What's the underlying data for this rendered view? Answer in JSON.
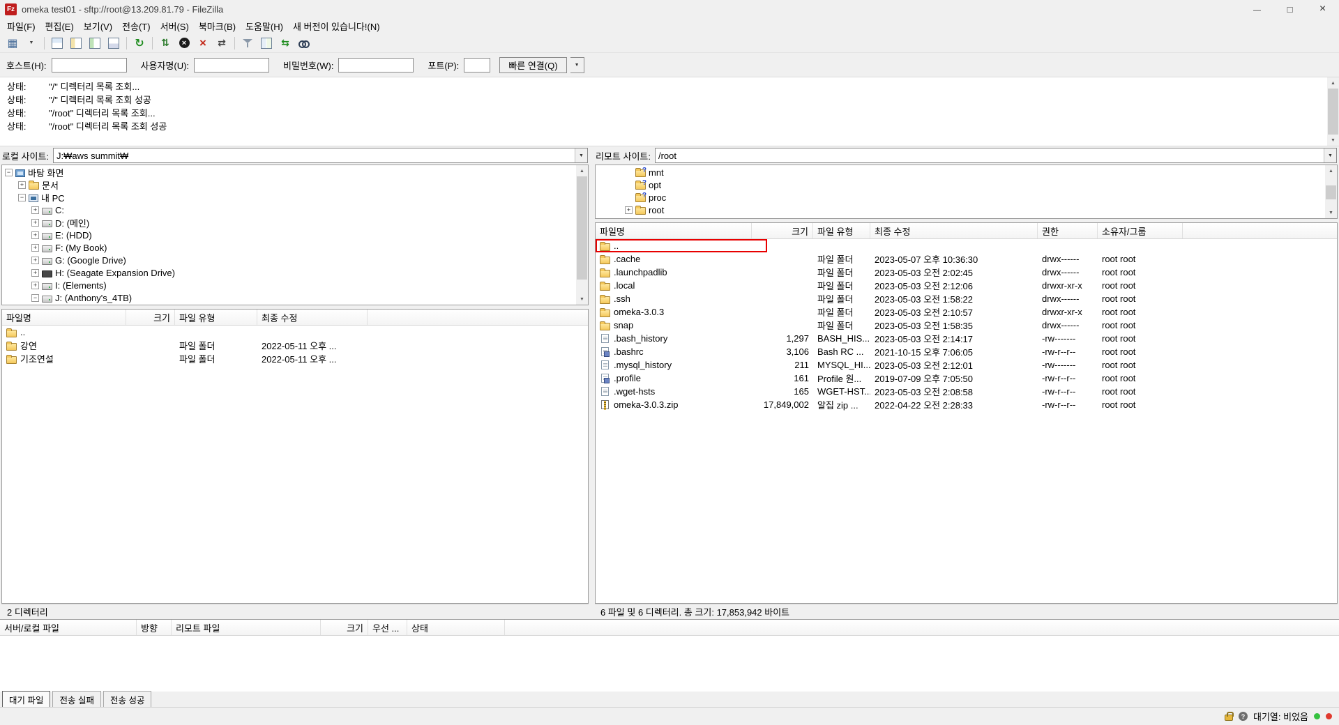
{
  "window": {
    "title": "omeka test01 - sftp://root@13.209.81.79 - FileZilla",
    "controls": [
      "minimize",
      "maximize",
      "close"
    ]
  },
  "menu": {
    "items": [
      {
        "label": "파일(F)"
      },
      {
        "label": "편집(E)"
      },
      {
        "label": "보기(V)"
      },
      {
        "label": "전송(T)"
      },
      {
        "label": "서버(S)"
      },
      {
        "label": "북마크(B)"
      },
      {
        "label": "도움말(H)"
      },
      {
        "label": "새 버전이 있습니다!(N)"
      }
    ]
  },
  "toolbar": {
    "items": [
      "site-manager",
      "site-manager-dropdown",
      "|",
      "toggle-message-log",
      "toggle-local-tree",
      "toggle-remote-tree",
      "toggle-transfer-queue",
      "|",
      "refresh",
      "|",
      "process-queue",
      "cancel",
      "disconnect",
      "reconnect",
      "|",
      "filter",
      "compare-directories",
      "synchronized-browsing",
      "find-files"
    ]
  },
  "quickconnect": {
    "host_label": "호스트(H):",
    "username_label": "사용자명(U):",
    "password_label": "비밀번호(W):",
    "port_label": "포트(P):",
    "connect_button": "빠른 연결(Q)"
  },
  "log": {
    "entries": [
      {
        "prefix": "상태:",
        "message": "\"/\" 디렉터리 목록 조회..."
      },
      {
        "prefix": "상태:",
        "message": "\"/\" 디렉터리 목록 조회 성공"
      },
      {
        "prefix": "상태:",
        "message": "\"/root\" 디렉터리 목록 조회..."
      },
      {
        "prefix": "상태:",
        "message": "\"/root\" 디렉터리 목록 조회 성공"
      }
    ]
  },
  "local": {
    "site_label": "로컬 사이트:",
    "site_path": "J:₩aws summit₩",
    "tree": [
      {
        "indent": 0,
        "expander": "−",
        "icon": "desktop",
        "label": "바탕 화면"
      },
      {
        "indent": 1,
        "expander": "+",
        "icon": "folder",
        "label": "문서"
      },
      {
        "indent": 1,
        "expander": "−",
        "icon": "computer",
        "label": "내 PC"
      },
      {
        "indent": 2,
        "expander": "+",
        "icon": "drive",
        "label": "C:"
      },
      {
        "indent": 2,
        "expander": "+",
        "icon": "drive",
        "label": "D: (메인)"
      },
      {
        "indent": 2,
        "expander": "+",
        "icon": "drive",
        "label": "E: (HDD)"
      },
      {
        "indent": 2,
        "expander": "+",
        "icon": "drive",
        "label": "F: (My Book)"
      },
      {
        "indent": 2,
        "expander": "+",
        "icon": "drive",
        "label": "G: (Google Drive)"
      },
      {
        "indent": 2,
        "expander": "+",
        "icon": "drive-dark",
        "label": "H: (Seagate Expansion Drive)"
      },
      {
        "indent": 2,
        "expander": "+",
        "icon": "drive",
        "label": "I: (Elements)"
      },
      {
        "indent": 2,
        "expander": "−",
        "icon": "drive",
        "label": "J: (Anthony's_4TB)"
      }
    ],
    "columns": [
      {
        "key": "name",
        "label": "파일명"
      },
      {
        "key": "size",
        "label": "크기"
      },
      {
        "key": "type",
        "label": "파일 유형"
      },
      {
        "key": "mod",
        "label": "최종 수정"
      }
    ],
    "rows": [
      {
        "name": "..",
        "icon": "folder",
        "size": "",
        "type": "",
        "modified": ""
      },
      {
        "name": "강연",
        "icon": "folder",
        "size": "",
        "type": "파일 폴더",
        "modified": "2022-05-11 오후 ..."
      },
      {
        "name": "기조연설",
        "icon": "folder",
        "size": "",
        "type": "파일 폴더",
        "modified": "2022-05-11 오후 ..."
      }
    ],
    "status": "2 디렉터리"
  },
  "remote": {
    "site_label": "리모트 사이트:",
    "site_path": "/root",
    "tree": [
      {
        "indent": 2,
        "expander": "",
        "icon": "folder-question",
        "label": "mnt"
      },
      {
        "indent": 2,
        "expander": "",
        "icon": "folder-question",
        "label": "opt"
      },
      {
        "indent": 2,
        "expander": "",
        "icon": "folder-question",
        "label": "proc"
      },
      {
        "indent": 2,
        "expander": "+",
        "icon": "folder",
        "label": "root"
      }
    ],
    "columns": [
      {
        "key": "name",
        "label": "파일명"
      },
      {
        "key": "size",
        "label": "크기"
      },
      {
        "key": "type",
        "label": "파일 유형"
      },
      {
        "key": "mod",
        "label": "최종 수정"
      },
      {
        "key": "perm",
        "label": "권한"
      },
      {
        "key": "owner",
        "label": "소유자/그룹"
      }
    ],
    "rows": [
      {
        "name": "..",
        "icon": "folder",
        "size": "",
        "type": "",
        "modified": "",
        "perms": "",
        "owner": "",
        "highlighted": true
      },
      {
        "name": ".cache",
        "icon": "folder",
        "size": "",
        "type": "파일 폴더",
        "modified": "2023-05-07 오후 10:36:30",
        "perms": "drwx------",
        "owner": "root root"
      },
      {
        "name": ".launchpadlib",
        "icon": "folder",
        "size": "",
        "type": "파일 폴더",
        "modified": "2023-05-03 오전 2:02:45",
        "perms": "drwx------",
        "owner": "root root"
      },
      {
        "name": ".local",
        "icon": "folder",
        "size": "",
        "type": "파일 폴더",
        "modified": "2023-05-03 오전 2:12:06",
        "perms": "drwxr-xr-x",
        "owner": "root root"
      },
      {
        "name": ".ssh",
        "icon": "folder",
        "size": "",
        "type": "파일 폴더",
        "modified": "2023-05-03 오전 1:58:22",
        "perms": "drwx------",
        "owner": "root root"
      },
      {
        "name": "omeka-3.0.3",
        "icon": "folder",
        "size": "",
        "type": "파일 폴더",
        "modified": "2023-05-03 오전 2:10:57",
        "perms": "drwxr-xr-x",
        "owner": "root root"
      },
      {
        "name": "snap",
        "icon": "folder",
        "size": "",
        "type": "파일 폴더",
        "modified": "2023-05-03 오전 1:58:35",
        "perms": "drwx------",
        "owner": "root root"
      },
      {
        "name": ".bash_history",
        "icon": "file",
        "size": "1,297",
        "type": "BASH_HIS...",
        "modified": "2023-05-03 오전 2:14:17",
        "perms": "-rw-------",
        "owner": "root root"
      },
      {
        "name": ".bashrc",
        "icon": "script",
        "size": "3,106",
        "type": "Bash RC ...",
        "modified": "2021-10-15 오후 7:06:05",
        "perms": "-rw-r--r--",
        "owner": "root root"
      },
      {
        "name": ".mysql_history",
        "icon": "file",
        "size": "211",
        "type": "MYSQL_HI...",
        "modified": "2023-05-03 오전 2:12:01",
        "perms": "-rw-------",
        "owner": "root root"
      },
      {
        "name": ".profile",
        "icon": "script",
        "size": "161",
        "type": "Profile 원...",
        "modified": "2019-07-09 오후 7:05:50",
        "perms": "-rw-r--r--",
        "owner": "root root"
      },
      {
        "name": ".wget-hsts",
        "icon": "file",
        "size": "165",
        "type": "WGET-HST...",
        "modified": "2023-05-03 오전 2:08:58",
        "perms": "-rw-r--r--",
        "owner": "root root"
      },
      {
        "name": "omeka-3.0.3.zip",
        "icon": "zip",
        "size": "17,849,002",
        "type": "알집 zip ...",
        "modified": "2022-04-22 오전 2:28:33",
        "perms": "-rw-r--r--",
        "owner": "root root"
      }
    ],
    "status": "6 파일 및 6 디렉터리. 총 크기: 17,853,942 바이트"
  },
  "queue": {
    "columns": [
      {
        "key": "qserver",
        "label": "서버/로컬 파일"
      },
      {
        "key": "qdir",
        "label": "방향"
      },
      {
        "key": "qremote",
        "label": "리모트 파일"
      },
      {
        "key": "qsize",
        "label": "크기"
      },
      {
        "key": "qpri",
        "label": "우선 ..."
      },
      {
        "key": "qstatus",
        "label": "상태"
      }
    ],
    "tabs": [
      {
        "label": "대기 파일",
        "active": true
      },
      {
        "label": "전송 실패",
        "active": false
      },
      {
        "label": "전송 성공",
        "active": false
      }
    ]
  },
  "statusbar": {
    "queue_text": "대기열: 비었음"
  }
}
